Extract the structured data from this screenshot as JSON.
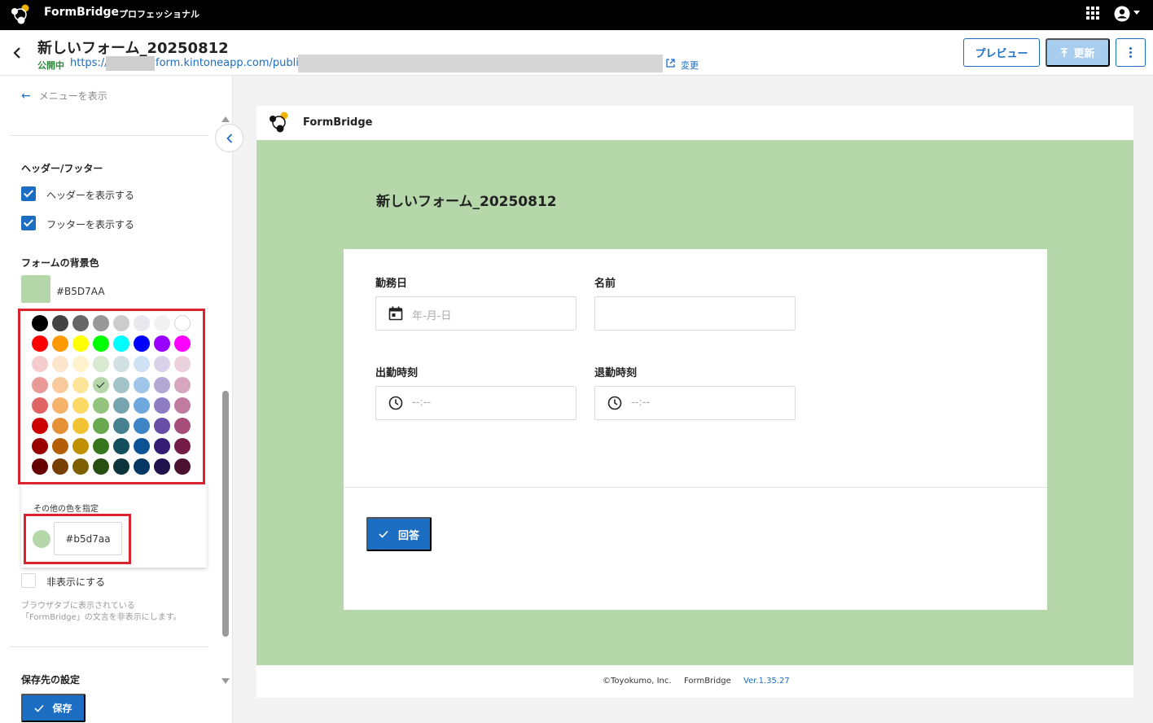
{
  "app": {
    "brand": "FormBridge",
    "plan": "プロフェッショナル"
  },
  "header": {
    "title": "新しいフォーム_20250812",
    "status": "公開中",
    "url_prefix": "https://",
    "url_domain": "form.kintoneapp.com/public/",
    "change_label": "変更",
    "preview_label": "プレビュー",
    "update_label": "更新"
  },
  "sidebar": {
    "menu_label": "メニューを表示",
    "section_header_footer": "ヘッダー/フッター",
    "show_header": "ヘッダーを表示する",
    "show_footer": "フッターを表示する",
    "section_bg": "フォームの背景色",
    "bg_hex": "#B5D7AA",
    "other_color_label": "その他の色を指定",
    "custom_hex": "#b5d7aa",
    "hide_label": "非表示にする",
    "hint_line1": "ブラウザタブに表示されている",
    "hint_line2": "「FormBridge」の文言を非表示にします。",
    "section_save": "保存先の設定",
    "save_label": "保存"
  },
  "palette": {
    "selected": "#b5d7aa",
    "colors": [
      "#000000",
      "#434343",
      "#666666",
      "#999999",
      "#cccccc",
      "#e8e8ee",
      "#f1f1f1",
      "#ffffff",
      "#ff0000",
      "#ff9900",
      "#ffff00",
      "#00ff00",
      "#00ffff",
      "#0000ff",
      "#9900ff",
      "#ff00ff",
      "#f4cccc",
      "#fce5cd",
      "#fff2cc",
      "#d9ead3",
      "#d0e0e3",
      "#cfe2f3",
      "#d9d2e9",
      "#ead1dc",
      "#ea9999",
      "#f9cb9c",
      "#ffe599",
      "#b5d7aa",
      "#a2c4c9",
      "#9fc5e8",
      "#b4a7d6",
      "#d5a6bd",
      "#e06666",
      "#f6b26b",
      "#ffd966",
      "#93c47d",
      "#76a5af",
      "#6fa8dc",
      "#8e7cc3",
      "#c27ba0",
      "#cc0000",
      "#e69138",
      "#f1c232",
      "#6aa84f",
      "#45818e",
      "#3d85c6",
      "#674ea7",
      "#a64d79",
      "#990000",
      "#b45f06",
      "#bf9000",
      "#38761d",
      "#134f5c",
      "#0b5394",
      "#351c75",
      "#741b47",
      "#660000",
      "#783f04",
      "#7f6000",
      "#274e13",
      "#0c343d",
      "#073763",
      "#20124d",
      "#4c1130"
    ]
  },
  "preview": {
    "brand": "FormBridge",
    "title": "新しいフォーム_20250812",
    "bg_color": "#b5d7aa",
    "fields": {
      "date_label": "勤務日",
      "date_placeholder": "年-月-日",
      "name_label": "名前",
      "in_label": "出勤時刻",
      "in_placeholder": "--:--",
      "out_label": "退勤時刻",
      "out_placeholder": "--:--"
    },
    "answer_label": "回答",
    "footer_copy": "©Toyokumo, Inc.",
    "footer_brand": "FormBridge",
    "footer_version": "Ver.1.35.27"
  }
}
